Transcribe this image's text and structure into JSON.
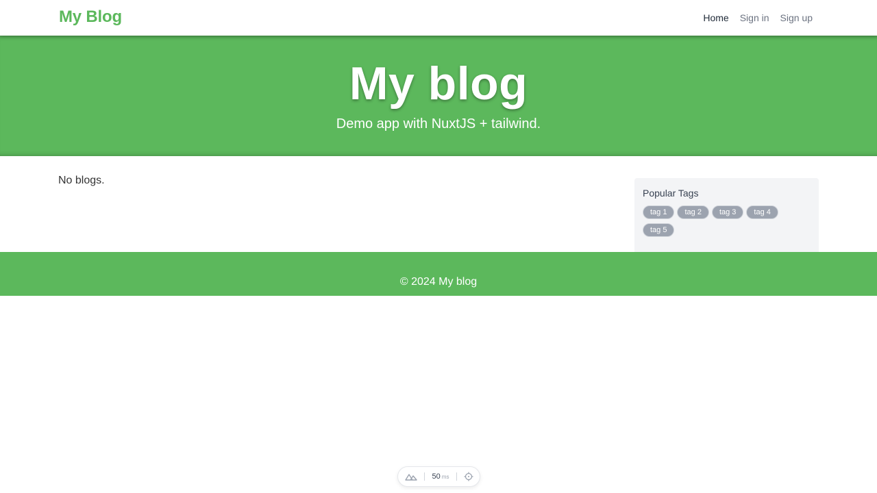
{
  "navbar": {
    "brand": "My Blog",
    "links": [
      {
        "label": "Home",
        "active": true
      },
      {
        "label": "Sign in",
        "active": false
      },
      {
        "label": "Sign up",
        "active": false
      }
    ]
  },
  "banner": {
    "title": "My blog",
    "subtitle": "Demo app with NuxtJS + tailwind."
  },
  "main": {
    "empty_message": "No blogs."
  },
  "sidebar": {
    "title": "Popular Tags",
    "tags": [
      "tag 1",
      "tag 2",
      "tag 3",
      "tag 4",
      "tag 5"
    ]
  },
  "footer": {
    "text": "© 2024 My blog"
  },
  "dev_toolbar": {
    "ms_value": "50",
    "ms_unit": "ms",
    "icons": [
      "nuxt-logo-icon",
      "crosshair-icon"
    ]
  },
  "colors": {
    "brand_green": "#5cb85c",
    "tag_bg": "#9ca3af",
    "sidebar_bg": "#f3f4f6"
  }
}
